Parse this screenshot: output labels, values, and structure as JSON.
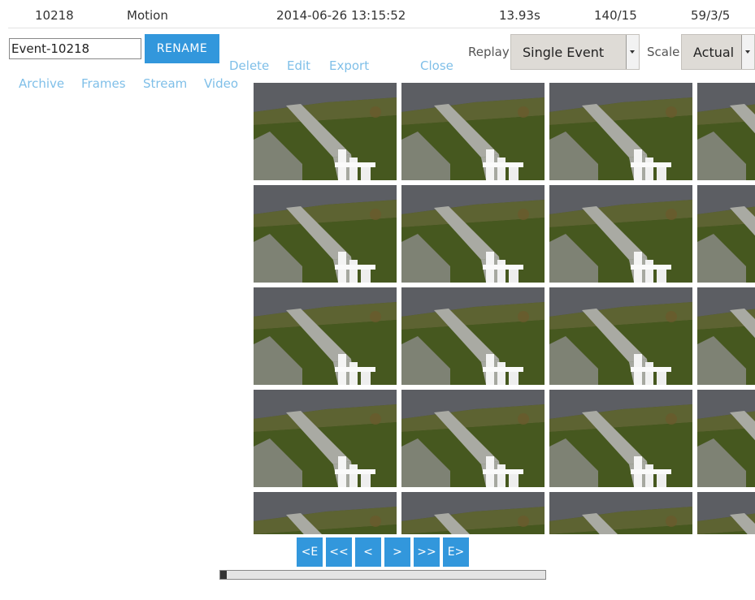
{
  "header": {
    "event_id": "10218",
    "cause": "Motion",
    "datetime": "2014-06-26 13:15:52",
    "duration": "13.93s",
    "frames": "140/15",
    "scores": "59/3/5"
  },
  "rename": {
    "value": "Event-10218",
    "button_label": "RENAME"
  },
  "actions": {
    "delete": "Delete",
    "edit": "Edit",
    "export": "Export",
    "close": "Close"
  },
  "nav": {
    "archive": "Archive",
    "frames": "Frames",
    "stream": "Stream",
    "video": "Video"
  },
  "controls": {
    "replay_label": "Replay",
    "replay_value": "Single Event",
    "scale_label": "Scale",
    "scale_value": "Actual"
  },
  "pager": {
    "first_event": "<E",
    "prev_fast": "<<",
    "prev": "<",
    "next": ">",
    "next_fast": ">>",
    "last_event": "E>"
  },
  "playback": {
    "progress": 0.02
  },
  "colors": {
    "accent": "#3297dc",
    "link": "#7fbfe8"
  },
  "thumbnail": {
    "icon": "camera-frame-thumbnail",
    "rows": 5,
    "cols": 4
  }
}
